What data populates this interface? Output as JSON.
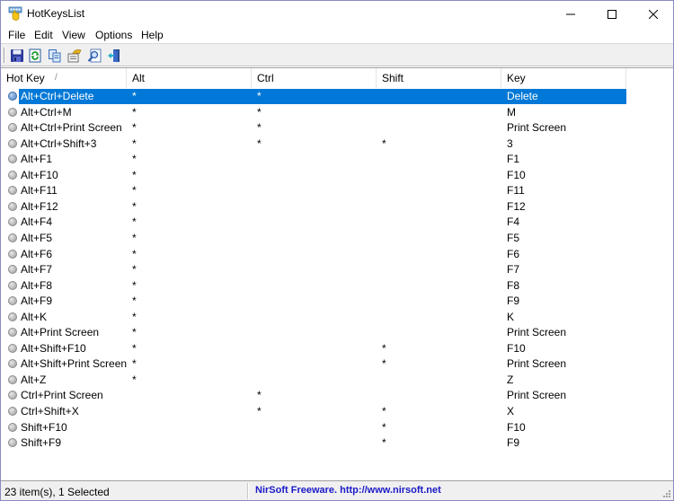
{
  "window": {
    "title": "HotKeysList",
    "controls": {
      "minimize": "minimize",
      "maximize": "maximize",
      "close": "close"
    }
  },
  "menu": {
    "items": [
      {
        "label": "File"
      },
      {
        "label": "Edit"
      },
      {
        "label": "View"
      },
      {
        "label": "Options"
      },
      {
        "label": "Help"
      }
    ]
  },
  "toolbar": {
    "buttons": [
      {
        "icon": "save-icon",
        "tooltip": "Save Selected Items"
      },
      {
        "icon": "refresh-icon",
        "tooltip": "Refresh"
      },
      {
        "icon": "copy-icon",
        "tooltip": "Copy Selected Items"
      },
      {
        "icon": "properties-icon",
        "tooltip": "Properties"
      },
      {
        "icon": "find-icon",
        "tooltip": "Find"
      },
      {
        "icon": "exit-icon",
        "tooltip": "Exit"
      }
    ]
  },
  "list": {
    "columns": [
      {
        "label": "Hot Key",
        "sort": "/"
      },
      {
        "label": "Alt"
      },
      {
        "label": "Ctrl"
      },
      {
        "label": "Shift"
      },
      {
        "label": "Key"
      }
    ],
    "rows": [
      {
        "hotkey": "Alt+Ctrl+Delete",
        "alt": "*",
        "ctrl": "*",
        "shift": "",
        "key": "Delete",
        "selected": true
      },
      {
        "hotkey": "Alt+Ctrl+M",
        "alt": "*",
        "ctrl": "*",
        "shift": "",
        "key": "M"
      },
      {
        "hotkey": "Alt+Ctrl+Print Screen",
        "alt": "*",
        "ctrl": "*",
        "shift": "",
        "key": "Print Screen"
      },
      {
        "hotkey": "Alt+Ctrl+Shift+3",
        "alt": "*",
        "ctrl": "*",
        "shift": "*",
        "key": "3"
      },
      {
        "hotkey": "Alt+F1",
        "alt": "*",
        "ctrl": "",
        "shift": "",
        "key": "F1"
      },
      {
        "hotkey": "Alt+F10",
        "alt": "*",
        "ctrl": "",
        "shift": "",
        "key": "F10"
      },
      {
        "hotkey": "Alt+F11",
        "alt": "*",
        "ctrl": "",
        "shift": "",
        "key": "F11"
      },
      {
        "hotkey": "Alt+F12",
        "alt": "*",
        "ctrl": "",
        "shift": "",
        "key": "F12"
      },
      {
        "hotkey": "Alt+F4",
        "alt": "*",
        "ctrl": "",
        "shift": "",
        "key": "F4"
      },
      {
        "hotkey": "Alt+F5",
        "alt": "*",
        "ctrl": "",
        "shift": "",
        "key": "F5"
      },
      {
        "hotkey": "Alt+F6",
        "alt": "*",
        "ctrl": "",
        "shift": "",
        "key": "F6"
      },
      {
        "hotkey": "Alt+F7",
        "alt": "*",
        "ctrl": "",
        "shift": "",
        "key": "F7"
      },
      {
        "hotkey": "Alt+F8",
        "alt": "*",
        "ctrl": "",
        "shift": "",
        "key": "F8"
      },
      {
        "hotkey": "Alt+F9",
        "alt": "*",
        "ctrl": "",
        "shift": "",
        "key": "F9"
      },
      {
        "hotkey": "Alt+K",
        "alt": "*",
        "ctrl": "",
        "shift": "",
        "key": "K"
      },
      {
        "hotkey": "Alt+Print Screen",
        "alt": "*",
        "ctrl": "",
        "shift": "",
        "key": "Print Screen"
      },
      {
        "hotkey": "Alt+Shift+F10",
        "alt": "*",
        "ctrl": "",
        "shift": "*",
        "key": "F10"
      },
      {
        "hotkey": "Alt+Shift+Print Screen",
        "alt": "*",
        "ctrl": "",
        "shift": "*",
        "key": "Print Screen"
      },
      {
        "hotkey": "Alt+Z",
        "alt": "*",
        "ctrl": "",
        "shift": "",
        "key": "Z"
      },
      {
        "hotkey": "Ctrl+Print Screen",
        "alt": "",
        "ctrl": "*",
        "shift": "",
        "key": "Print Screen"
      },
      {
        "hotkey": "Ctrl+Shift+X",
        "alt": "",
        "ctrl": "*",
        "shift": "*",
        "key": "X"
      },
      {
        "hotkey": "Shift+F10",
        "alt": "",
        "ctrl": "",
        "shift": "*",
        "key": "F10"
      },
      {
        "hotkey": "Shift+F9",
        "alt": "",
        "ctrl": "",
        "shift": "*",
        "key": "F9"
      }
    ]
  },
  "status": {
    "count_text": "23 item(s), 1 Selected",
    "link_text": "NirSoft Freeware.  http://www.nirsoft.net"
  },
  "colors": {
    "selection": "#0078d7",
    "link": "#1a1ac8",
    "window_border": "#8a8ac0"
  }
}
